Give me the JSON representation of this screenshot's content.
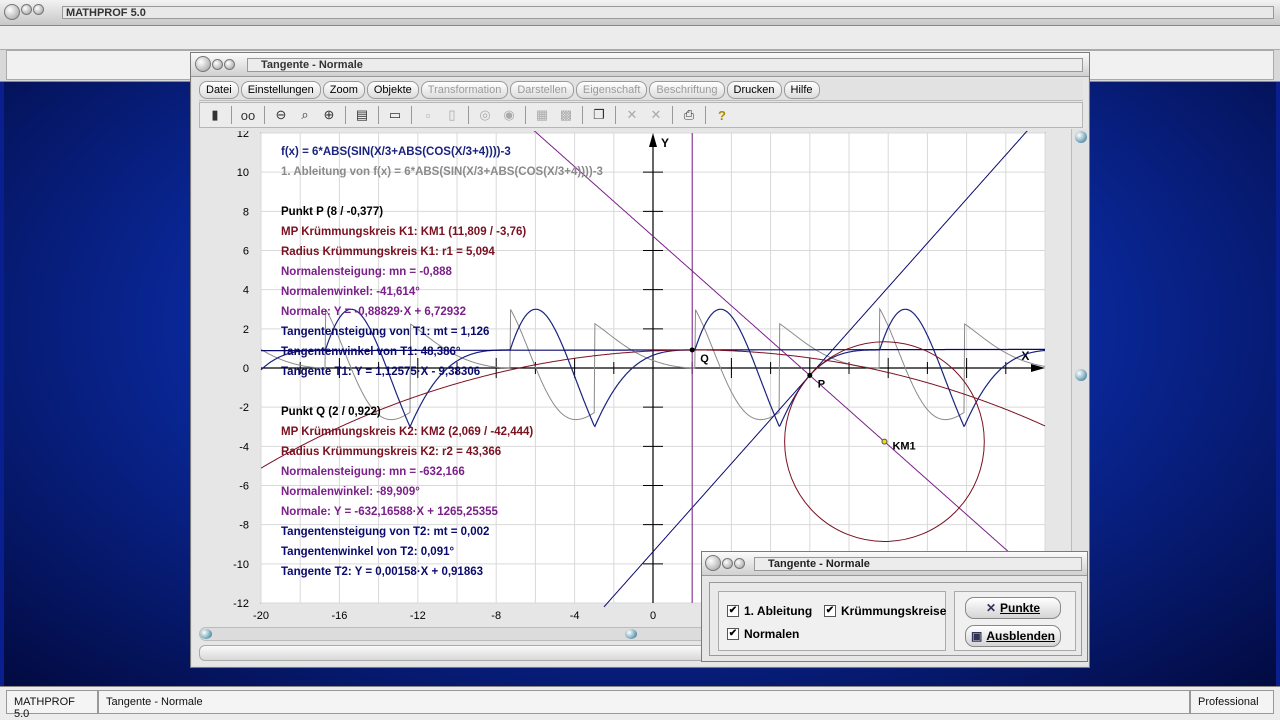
{
  "app": {
    "title": "MATHPROF 5.0",
    "status": {
      "app": "MATHPROF 5.0",
      "module": "Tangente - Normale",
      "edition": "Professional"
    }
  },
  "window": {
    "title": "Tangente - Normale",
    "menu": [
      {
        "label": "Datei",
        "enabled": true
      },
      {
        "label": "Einstellungen",
        "enabled": true
      },
      {
        "label": "Zoom",
        "enabled": true
      },
      {
        "label": "Objekte",
        "enabled": true
      },
      {
        "label": "Transformation",
        "enabled": false
      },
      {
        "label": "Darstellen",
        "enabled": false
      },
      {
        "label": "Eigenschaft",
        "enabled": false
      },
      {
        "label": "Beschriftung",
        "enabled": false
      },
      {
        "label": "Drucken",
        "enabled": true
      },
      {
        "label": "Hilfe",
        "enabled": true
      }
    ]
  },
  "plot": {
    "axis_y_label": "Y",
    "axis_x_label": "X",
    "x_ticks": [
      "-20",
      "-16",
      "-12",
      "-8",
      "-4",
      "0"
    ],
    "y_ticks": [
      "12",
      "10",
      "8",
      "6",
      "4",
      "2",
      "0",
      "-2",
      "-4",
      "-6",
      "-8",
      "-10",
      "-12"
    ],
    "point_labels": {
      "P": "P",
      "Q": "Q",
      "KM1": "KM1"
    },
    "info": {
      "f": "f(x) = 6*ABS(SIN(X/3+ABS(COS(X/3+4))))-3",
      "df": "1. Ableitung von f(x) = 6*ABS(SIN(X/3+ABS(COS(X/3+4))))-3",
      "p": [
        "Punkt P (8 / -0,377)",
        "MP Krümmungskreis K1: KM1 (11,809 / -3,76)",
        "Radius Krümmungskreis K1: r1 = 5,094",
        "Normalensteigung: mn = -0,888",
        "Normalenwinkel: -41,614°",
        "Normale: Y = -0,88829·X + 6,72932",
        "Tangentensteigung von T1: mt = 1,126",
        "Tangentenwinkel von T1: 48,386°",
        "Tangente T1: Y = 1,12575·X - 9,38306"
      ],
      "q": [
        "Punkt Q (2 / 0,922)",
        "MP Krümmungskreis K2: KM2 (2,069 / -42,444)",
        "Radius Krümmungskreis K2: r2 = 43,366",
        "Normalensteigung: mn = -632,166",
        "Normalenwinkel: -89,909°",
        "Normale: Y = -632,16588·X + 1265,25355",
        "Tangentensteigung von T2: mt = 0,002",
        "Tangentenwinkel von T2: 0,091°",
        "Tangente T2: Y = 0,00158·X + 0,91863"
      ]
    },
    "colors": {
      "function": "#1a237e",
      "derivative": "#8a8a8a",
      "normal": "#7b1f8a",
      "tangent": "#0a0a6e",
      "circle": "#7a1020",
      "grid": "#d9d9d9"
    }
  },
  "dialog": {
    "title": "Tangente - Normale",
    "checkboxes": [
      {
        "label": "1. Ableitung",
        "checked": true
      },
      {
        "label": "Krümmungskreise",
        "checked": true
      },
      {
        "label": "Normalen",
        "checked": true
      }
    ],
    "buttons": {
      "points": "Punkte",
      "hide": "Ausblenden"
    }
  }
}
